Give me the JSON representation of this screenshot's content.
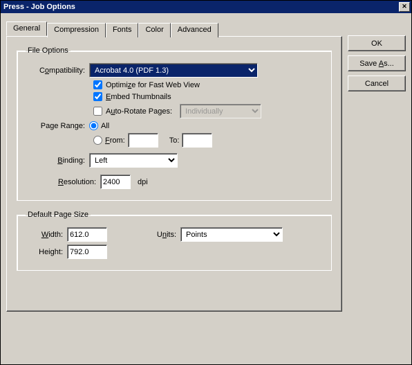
{
  "window": {
    "title": "Press - Job Options"
  },
  "tabs": {
    "general": "General",
    "compression": "Compression",
    "fonts": "Fonts",
    "color": "Color",
    "advanced": "Advanced"
  },
  "buttons": {
    "ok": "OK",
    "save_as": "Save As...",
    "cancel": "Cancel"
  },
  "file_options": {
    "legend": "File Options",
    "compatibility_label_pre": "C",
    "compatibility_label_u": "o",
    "compatibility_label_post": "mpatibility:",
    "compatibility_value": "Acrobat 4.0 (PDF 1.3)",
    "optimize_pre": "Optimi",
    "optimize_u": "z",
    "optimize_post": "e for Fast Web View",
    "embed_pre": "",
    "embed_u": "E",
    "embed_post": "mbed Thumbnails",
    "autorotate_pre": "A",
    "autorotate_u": "u",
    "autorotate_post": "to-Rotate Pages:",
    "autorotate_value": "Individually",
    "page_range_label_pre": "Pa",
    "page_range_label_u": "g",
    "page_range_label_post": "e Range:",
    "all_label": "All",
    "from_u": "F",
    "from_post": "rom:",
    "from_value": "",
    "to_label": "To:",
    "to_value": "",
    "binding_pre": "",
    "binding_u": "B",
    "binding_post": "inding:",
    "binding_value": "Left",
    "resolution_pre": "",
    "resolution_u": "R",
    "resolution_post": "esolution:",
    "resolution_value": "2400",
    "resolution_unit": "dpi"
  },
  "default_page_size": {
    "legend": "Default Page Size",
    "width_pre": "",
    "width_u": "W",
    "width_post": "idth:",
    "width_value": "612.0",
    "units_pre": "U",
    "units_u": "n",
    "units_post": "its:",
    "units_value": "Points",
    "height_pre": "Hei",
    "height_u": "g",
    "height_post": "ht:",
    "height_value": "792.0"
  }
}
